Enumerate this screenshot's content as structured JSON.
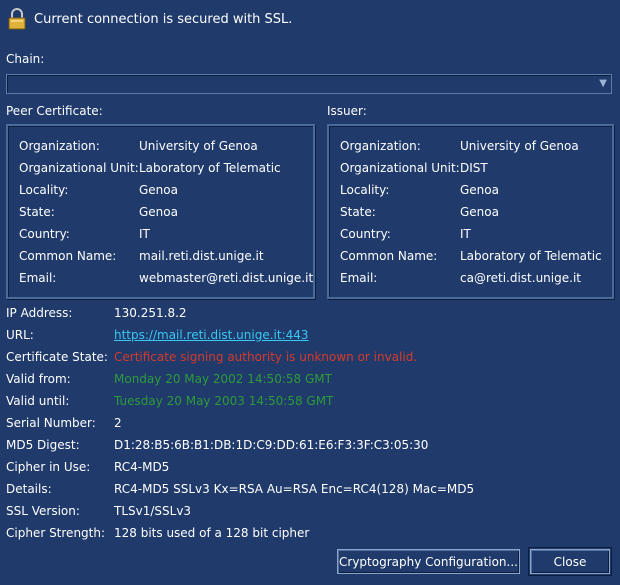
{
  "ssl_status": "Current connection is secured with SSL.",
  "chain": {
    "label": "Chain:",
    "value": ""
  },
  "peer": {
    "title": "Peer Certificate:",
    "fields": [
      {
        "label": "Organization:",
        "value": "University of Genoa"
      },
      {
        "label": "Organizational Unit:",
        "value": "Laboratory of Telematic"
      },
      {
        "label": "Locality:",
        "value": "Genoa"
      },
      {
        "label": "State:",
        "value": "Genoa"
      },
      {
        "label": "Country:",
        "value": "IT"
      },
      {
        "label": "Common Name:",
        "value": "mail.reti.dist.unige.it"
      },
      {
        "label": "Email:",
        "value": "webmaster@reti.dist.unige.it"
      }
    ]
  },
  "issuer": {
    "title": "Issuer:",
    "fields": [
      {
        "label": "Organization:",
        "value": "University of Genoa"
      },
      {
        "label": "Organizational Unit:",
        "value": "DIST"
      },
      {
        "label": "Locality:",
        "value": "Genoa"
      },
      {
        "label": "State:",
        "value": "Genoa"
      },
      {
        "label": "Country:",
        "value": "IT"
      },
      {
        "label": "Common Name:",
        "value": "Laboratory of Telematic"
      },
      {
        "label": "Email:",
        "value": "ca@reti.dist.unige.it"
      }
    ]
  },
  "details": [
    {
      "label": "IP Address:",
      "value": "130.251.8.2"
    },
    {
      "label": "URL:",
      "value": "https://mail.reti.dist.unige.it:443"
    },
    {
      "label": "Certificate State:",
      "value": "Certificate signing authority is unknown or invalid."
    },
    {
      "label": "Valid from:",
      "value": "Monday 20 May 2002 14:50:58 GMT"
    },
    {
      "label": "Valid until:",
      "value": "Tuesday 20 May 2003 14:50:58 GMT"
    },
    {
      "label": "Serial Number:",
      "value": "2"
    },
    {
      "label": "MD5 Digest:",
      "value": "D1:28:B5:6B:B1:DB:1D:C9:DD:61:E6:F3:3F:C3:05:30"
    },
    {
      "label": "Cipher in Use:",
      "value": "RC4-MD5"
    },
    {
      "label": "Details:",
      "value": "RC4-MD5 SSLv3 Kx=RSA Au=RSA Enc=RC4(128) Mac=MD5"
    },
    {
      "label": "SSL Version:",
      "value": "TLSv1/SSLv3"
    },
    {
      "label": "Cipher Strength:",
      "value": "128 bits used of a 128 bit cipher"
    }
  ],
  "buttons": {
    "crypto": "Cryptography Configuration...",
    "close": "Close"
  },
  "colors": {
    "background": "#1f3a6b",
    "valid_date": "#2e9b3a",
    "error": "#d63a2a",
    "link": "#38c8f0"
  },
  "icons": {
    "status": "padlock-icon"
  }
}
